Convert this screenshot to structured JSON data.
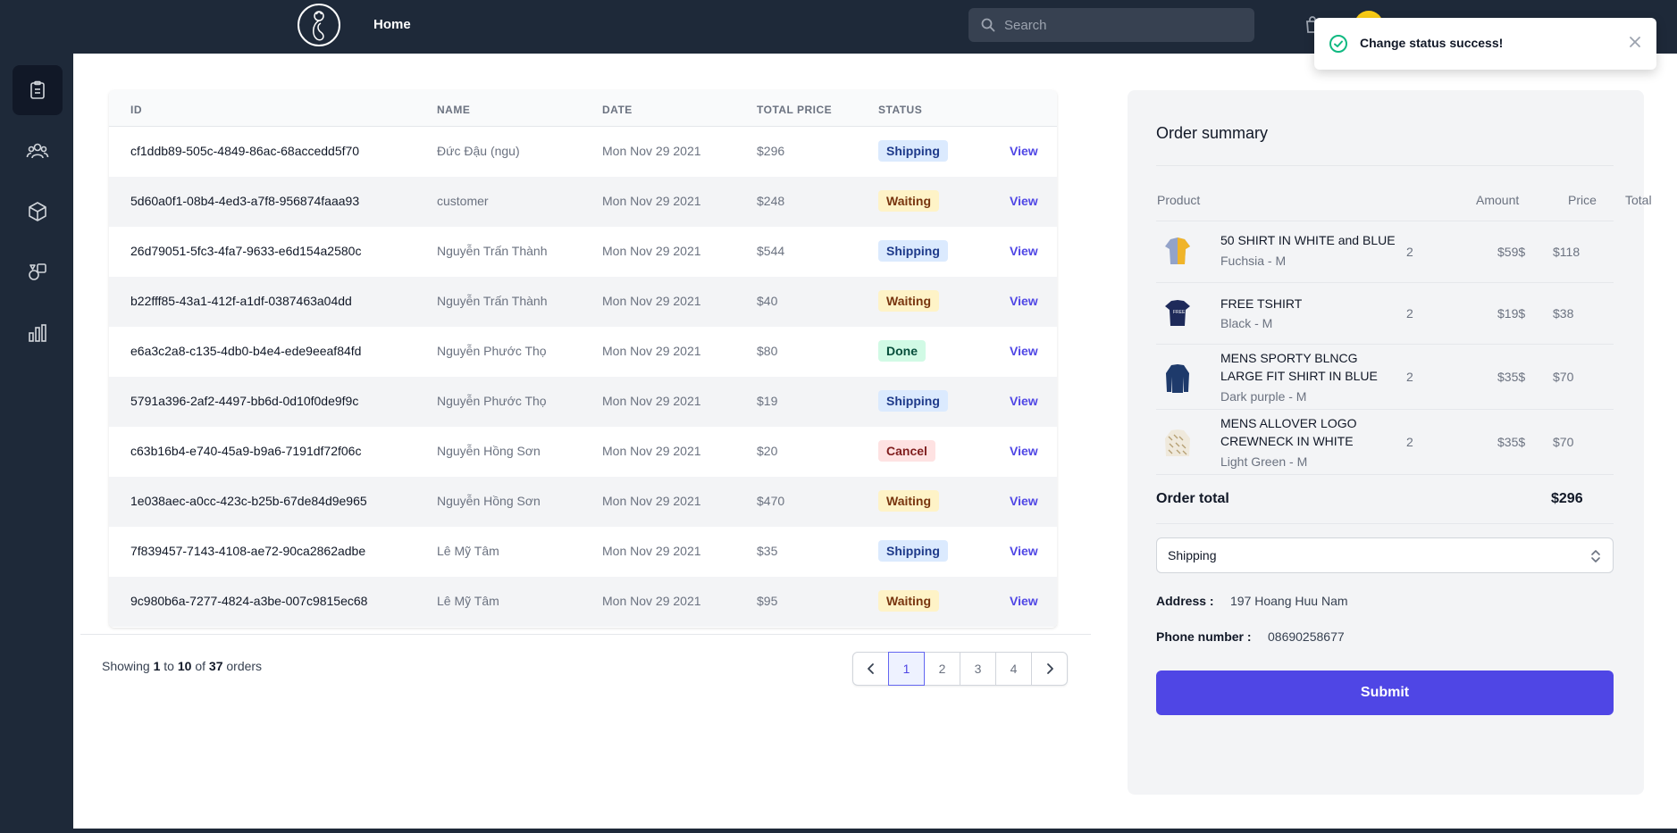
{
  "header": {
    "home_label": "Home",
    "search_placeholder": "Search"
  },
  "toast": {
    "message": "Change status success!"
  },
  "sidebar": {
    "items": [
      {
        "icon": "clipboard-icon",
        "active": true
      },
      {
        "icon": "users-icon",
        "active": false
      },
      {
        "icon": "cube-icon",
        "active": false
      },
      {
        "icon": "shapes-icon",
        "active": false
      },
      {
        "icon": "chart-bar-icon",
        "active": false
      }
    ]
  },
  "table": {
    "headers": [
      "ID",
      "NAME",
      "DATE",
      "TOTAL PRICE",
      "STATUS"
    ],
    "view_label": "View",
    "rows": [
      {
        "id": "cf1ddb89-505c-4849-86ac-68accedd5f70",
        "name": "Đức Đậu (ngu)",
        "date": "Mon Nov 29 2021",
        "total": "$296",
        "status": "Shipping"
      },
      {
        "id": "5d60a0f1-08b4-4ed3-a7f8-956874faaa93",
        "name": "customer",
        "date": "Mon Nov 29 2021",
        "total": "$248",
        "status": "Waiting"
      },
      {
        "id": "26d79051-5fc3-4fa7-9633-e6d154a2580c",
        "name": "Nguyễn Trấn Thành",
        "date": "Mon Nov 29 2021",
        "total": "$544",
        "status": "Shipping"
      },
      {
        "id": "b22fff85-43a1-412f-a1df-0387463a04dd",
        "name": "Nguyễn Trấn Thành",
        "date": "Mon Nov 29 2021",
        "total": "$40",
        "status": "Waiting"
      },
      {
        "id": "e6a3c2a8-c135-4db0-b4e4-ede9eeaf84fd",
        "name": "Nguyễn Phước Thọ",
        "date": "Mon Nov 29 2021",
        "total": "$80",
        "status": "Done"
      },
      {
        "id": "5791a396-2af2-4497-bb6d-0d10f0de9f9c",
        "name": "Nguyễn Phước Thọ",
        "date": "Mon Nov 29 2021",
        "total": "$19",
        "status": "Shipping"
      },
      {
        "id": "c63b16b4-e740-45a9-b9a6-7191df72f06c",
        "name": "Nguyễn Hồng Sơn",
        "date": "Mon Nov 29 2021",
        "total": "$20",
        "status": "Cancel"
      },
      {
        "id": "1e038aec-a0cc-423c-b25b-67de84d9e965",
        "name": "Nguyễn Hồng Sơn",
        "date": "Mon Nov 29 2021",
        "total": "$470",
        "status": "Waiting"
      },
      {
        "id": "7f839457-7143-4108-ae72-90ca2862adbe",
        "name": "Lê Mỹ Tâm",
        "date": "Mon Nov 29 2021",
        "total": "$35",
        "status": "Shipping"
      },
      {
        "id": "9c980b6a-7277-4824-a3be-007c9815ec68",
        "name": "Lê Mỹ Tâm",
        "date": "Mon Nov 29 2021",
        "total": "$95",
        "status": "Waiting"
      }
    ]
  },
  "pagination": {
    "showing_prefix": "Showing",
    "from": "1",
    "to_word": "to",
    "to": "10",
    "of_word": "of",
    "total": "37",
    "suffix": "orders",
    "pages": [
      "1",
      "2",
      "3",
      "4"
    ],
    "current_page": "1"
  },
  "summary": {
    "title": "Order summary",
    "headers": {
      "product": "Product",
      "amount": "Amount",
      "price": "Price",
      "total": "Total"
    },
    "products": [
      {
        "name": "50 SHIRT IN WHITE and BLUE",
        "variant": "Fuchsia - M",
        "amount": "2",
        "price": "$59$",
        "total": "$118"
      },
      {
        "name": "FREE TSHIRT",
        "variant": "Black - M",
        "amount": "2",
        "price": "$19$",
        "total": "$38"
      },
      {
        "name": "MENS SPORTY BLNCG LARGE FIT SHIRT IN BLUE",
        "variant": "Dark purple - M",
        "amount": "2",
        "price": "$35$",
        "total": "$70"
      },
      {
        "name": "MENS ALLOVER LOGO CREWNECK IN WHITE",
        "variant": "Light Green - M",
        "amount": "2",
        "price": "$35$",
        "total": "$70"
      }
    ],
    "order_total_label": "Order total",
    "order_total": "$296",
    "status_value": "Shipping",
    "address_label": "Address :",
    "address": "197 Hoang Huu Nam",
    "phone_label": "Phone number :",
    "phone": "08690258677",
    "submit_label": "Submit"
  },
  "colors": {
    "nav_bg": "#1e2939",
    "accent": "#4f46e5"
  }
}
